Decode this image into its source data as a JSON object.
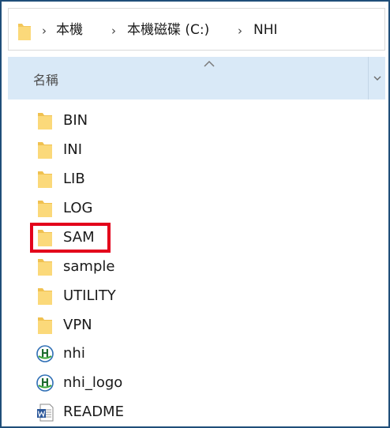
{
  "address_bar": {
    "crumbs": [
      "本機",
      "本機磁碟 (C:)",
      "NHI"
    ],
    "separator": "›"
  },
  "column_header": {
    "name_label": "名稱",
    "sort_indicator": "sort-ascending-icon",
    "dropdown_indicator": "chevron-down-icon"
  },
  "files": [
    {
      "name": "BIN",
      "type": "folder",
      "icon": "folder-icon"
    },
    {
      "name": "INI",
      "type": "folder",
      "icon": "folder-icon"
    },
    {
      "name": "LIB",
      "type": "folder",
      "icon": "folder-icon"
    },
    {
      "name": "LOG",
      "type": "folder",
      "icon": "folder-icon"
    },
    {
      "name": "SAM",
      "type": "folder",
      "icon": "folder-icon",
      "highlighted": true
    },
    {
      "name": "sample",
      "type": "folder",
      "icon": "folder-icon"
    },
    {
      "name": "UTILITY",
      "type": "folder",
      "icon": "folder-icon"
    },
    {
      "name": "VPN",
      "type": "folder",
      "icon": "folder-icon"
    },
    {
      "name": "nhi",
      "type": "application",
      "icon": "nhi-app-icon"
    },
    {
      "name": "nhi_logo",
      "type": "application",
      "icon": "nhi-app-icon"
    },
    {
      "name": "README",
      "type": "document",
      "icon": "word-document-icon"
    }
  ],
  "colors": {
    "folder": "#f8d77a",
    "header_bg": "#d9e9f7",
    "highlight": "#e3001b",
    "window_border": "#1f4e79"
  }
}
